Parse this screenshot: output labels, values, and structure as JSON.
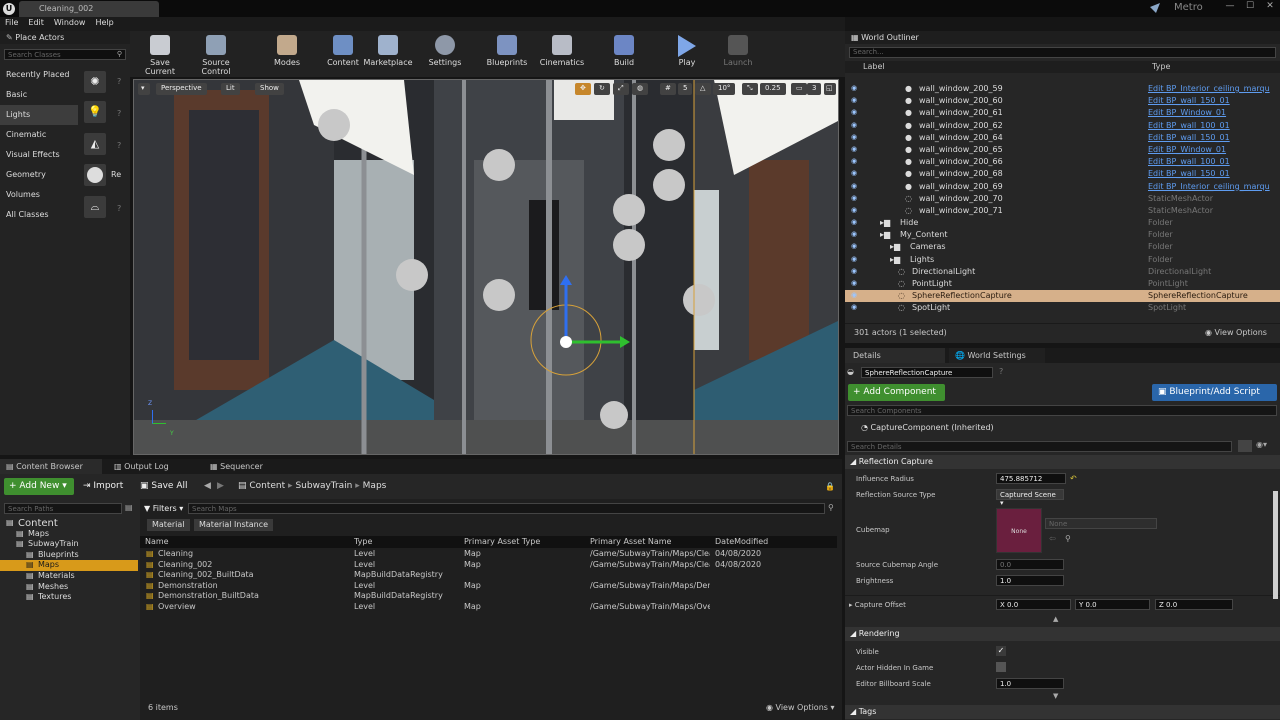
{
  "window": {
    "doc_tab": "Cleaning_002",
    "brand": "Metro",
    "menu": [
      "File",
      "Edit",
      "Window",
      "Help"
    ],
    "min": "—",
    "max": "☐",
    "close": "✕"
  },
  "place_actors": {
    "title": "Place Actors",
    "search_placeholder": "Search Classes",
    "categories": [
      "Recently Placed",
      "Basic",
      "Lights",
      "Cinematic",
      "Visual Effects",
      "Geometry",
      "Volumes",
      "All Classes"
    ],
    "selected": "Lights",
    "item_label": "Re"
  },
  "toolbar": {
    "buttons": [
      "Save Current",
      "Source Control",
      "Modes",
      "Content",
      "Marketplace",
      "Settings",
      "Blueprints",
      "Cinematics",
      "Build",
      "Play",
      "Launch"
    ]
  },
  "viewport": {
    "perspective": "Perspective",
    "lit": "Lit",
    "show": "Show",
    "grid_snap": "5",
    "rot_snap": "10°",
    "scale_snap": "0.25",
    "cam_speed": "3",
    "axis_z": "Z",
    "axis_y": "Y"
  },
  "outliner": {
    "title": "World Outliner",
    "search_placeholder": "Search...",
    "col_label": "Label",
    "col_type": "Type",
    "rows": [
      {
        "name": "wall_window_200_59",
        "type": "Edit BP_Interior_ceiling_marqu",
        "link": true,
        "indent": 905
      },
      {
        "name": "wall_window_200_60",
        "type": "Edit BP_wall_150_01",
        "link": true,
        "indent": 905
      },
      {
        "name": "wall_window_200_61",
        "type": "Edit BP_Window_01",
        "link": true,
        "indent": 905
      },
      {
        "name": "wall_window_200_62",
        "type": "Edit BP_wall_100_01",
        "link": true,
        "indent": 905
      },
      {
        "name": "wall_window_200_64",
        "type": "Edit BP_wall_150_01",
        "link": true,
        "indent": 905
      },
      {
        "name": "wall_window_200_65",
        "type": "Edit BP_Window_01",
        "link": true,
        "indent": 905
      },
      {
        "name": "wall_window_200_66",
        "type": "Edit BP_wall_100_01",
        "link": true,
        "indent": 905
      },
      {
        "name": "wall_window_200_68",
        "type": "Edit BP_wall_150_01",
        "link": true,
        "indent": 905
      },
      {
        "name": "wall_window_200_69",
        "type": "Edit BP_Interior_ceiling_marqu",
        "link": true,
        "indent": 905
      },
      {
        "name": "wall_window_200_70",
        "type": "StaticMeshActor",
        "link": false,
        "indent": 905
      },
      {
        "name": "wall_window_200_71",
        "type": "StaticMeshActor",
        "link": false,
        "indent": 905
      },
      {
        "name": "Hide",
        "type": "Folder",
        "link": false,
        "indent": 880
      },
      {
        "name": "My_Content",
        "type": "Folder",
        "link": false,
        "indent": 880
      },
      {
        "name": "Cameras",
        "type": "Folder",
        "link": false,
        "indent": 890
      },
      {
        "name": "Lights",
        "type": "Folder",
        "link": false,
        "indent": 890
      },
      {
        "name": "DirectionalLight",
        "type": "DirectionalLight",
        "link": false,
        "indent": 898
      },
      {
        "name": "PointLight",
        "type": "PointLight",
        "link": false,
        "indent": 898
      },
      {
        "name": "SphereReflectionCapture",
        "type": "SphereReflectionCapture",
        "link": false,
        "indent": 898,
        "sel": true
      },
      {
        "name": "SpotLight",
        "type": "SpotLight",
        "link": false,
        "indent": 898
      }
    ],
    "status": "301 actors (1 selected)",
    "view_options": "View Options"
  },
  "details": {
    "tab_details": "Details",
    "tab_world": "World Settings",
    "actor_name": "SphereReflectionCapture",
    "add_component": "+ Add Component",
    "blueprint": "Blueprint/Add Script",
    "search_components": "Search Components",
    "component": "CaptureComponent (Inherited)",
    "search_details": "Search Details",
    "section_reflection": "Reflection Capture",
    "influence_label": "Influence Radius",
    "influence_value": "475.885712",
    "source_type_label": "Reflection Source Type",
    "source_type_value": "Captured Scene",
    "cubemap_label": "Cubemap",
    "cubemap_none": "None",
    "cubemap_select": "None",
    "angle_label": "Source Cubemap Angle",
    "angle_value": "0.0",
    "brightness_label": "Brightness",
    "brightness_value": "1.0",
    "offset_label": "Capture Offset",
    "x": "X 0.0",
    "y": "Y 0.0",
    "z": "Z 0.0",
    "section_rendering": "Rendering",
    "visible_label": "Visible",
    "hidden_label": "Actor Hidden In Game",
    "billboard_label": "Editor Billboard Scale",
    "billboard_value": "1.0",
    "section_tags": "Tags"
  },
  "content_browser": {
    "tab_cb": "Content Browser",
    "tab_log": "Output Log",
    "tab_seq": "Sequencer",
    "add_new": "Add New",
    "import": "Import",
    "save_all": "Save All",
    "path": [
      "Content",
      "SubwayTrain",
      "Maps"
    ],
    "search_paths": "Search Paths",
    "filters": "Filters",
    "search_maps": "Search Maps",
    "filter_chips": [
      "Material",
      "Material Instance"
    ],
    "tree": [
      {
        "name": "Content",
        "level": 0
      },
      {
        "name": "Maps",
        "level": 1
      },
      {
        "name": "SubwayTrain",
        "level": 1
      },
      {
        "name": "Blueprints",
        "level": 2
      },
      {
        "name": "Maps",
        "level": 2,
        "sel": true
      },
      {
        "name": "Materials",
        "level": 2
      },
      {
        "name": "Meshes",
        "level": 2
      },
      {
        "name": "Textures",
        "level": 2
      }
    ],
    "columns": [
      "Name",
      "Type",
      "Primary Asset Type",
      "Primary Asset Name",
      "DateModified"
    ],
    "rows": [
      [
        "Cleaning",
        "Level",
        "Map",
        "/Game/SubwayTrain/Maps/Clea",
        "04/08/2020"
      ],
      [
        "Cleaning_002",
        "Level",
        "Map",
        "/Game/SubwayTrain/Maps/Clea",
        "04/08/2020"
      ],
      [
        "Cleaning_002_BuiltData",
        "MapBuildDataRegistry",
        "",
        "",
        ""
      ],
      [
        "Demonstration",
        "Level",
        "Map",
        "/Game/SubwayTrain/Maps/Dem",
        ""
      ],
      [
        "Demonstration_BuiltData",
        "MapBuildDataRegistry",
        "",
        "",
        ""
      ],
      [
        "Overview",
        "Level",
        "Map",
        "/Game/SubwayTrain/Maps/Overv",
        ""
      ]
    ],
    "count": "6 items",
    "view_options": "View Options"
  }
}
